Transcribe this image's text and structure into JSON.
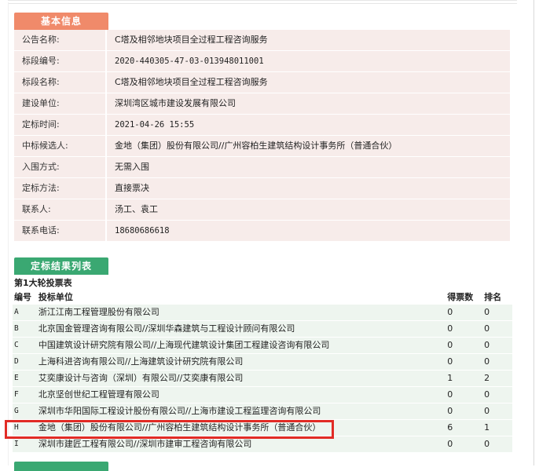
{
  "sections": {
    "basic_info_tab": "基本信息",
    "results_tab": "定标结果列表"
  },
  "basic_info": [
    {
      "label": "公告名称:",
      "value": "C塔及相邻地块项目全过程工程咨询服务"
    },
    {
      "label": "标段编号:",
      "value": "2020-440305-47-03-013948011001"
    },
    {
      "label": "标段名称:",
      "value": "C塔及相邻地块项目全过程工程咨询服务"
    },
    {
      "label": "建设单位:",
      "value": "深圳湾区城市建设发展有限公司"
    },
    {
      "label": "定标时间:",
      "value": "2021-04-26 15:55"
    },
    {
      "label": "中标候选人:",
      "value": "金地（集团）股份有限公司//广州容柏生建筑结构设计事务所（普通合伙）"
    },
    {
      "label": "入围方式:",
      "value": "无需入围"
    },
    {
      "label": "定标方法:",
      "value": "直接票决"
    },
    {
      "label": "联系人:",
      "value": "汤工、袁工"
    },
    {
      "label": "联系电话:",
      "value": "18680686618"
    }
  ],
  "round": {
    "title": "第1大轮投票表",
    "headers": {
      "no": "编号",
      "unit": "投标单位",
      "votes": "得票数",
      "rank": "排名"
    },
    "rows": [
      {
        "no": "A",
        "unit": "浙江江南工程管理股份有限公司",
        "votes": "0",
        "rank": "0"
      },
      {
        "no": "B",
        "unit": "北京国金管理咨询有限公司//深圳华森建筑与工程设计顾问有限公司",
        "votes": "0",
        "rank": "0"
      },
      {
        "no": "C",
        "unit": "中国建筑设计研究院有限公司//上海现代建筑设计集团工程建设咨询有限公司",
        "votes": "0",
        "rank": "0"
      },
      {
        "no": "D",
        "unit": "上海科进咨询有限公司//上海建筑设计研究院有限公司",
        "votes": "0",
        "rank": "0"
      },
      {
        "no": "E",
        "unit": "艾奕康设计与咨询（深圳）有限公司//艾奕康有限公司",
        "votes": "1",
        "rank": "2"
      },
      {
        "no": "F",
        "unit": "北京坚创世纪工程管理有限公司",
        "votes": "0",
        "rank": "0"
      },
      {
        "no": "G",
        "unit": "深圳市华阳国际工程设计股份有限公司//上海市建设工程监理咨询有限公司",
        "votes": "0",
        "rank": "0"
      },
      {
        "no": "H",
        "unit": "金地（集团）股份有限公司//广州容柏生建筑结构设计事务所（普通合伙）",
        "votes": "6",
        "rank": "1"
      },
      {
        "no": "I",
        "unit": "深圳市建匠工程有限公司//深圳市建审工程咨询有限公司",
        "votes": "0",
        "rank": "0"
      }
    ]
  },
  "colors": {
    "info_bg": "#f7ecea",
    "row_bg": "#eef5ef",
    "tab_orange": "#f08a6a",
    "tab_green": "#3aa872",
    "highlight": "#e12b25"
  }
}
